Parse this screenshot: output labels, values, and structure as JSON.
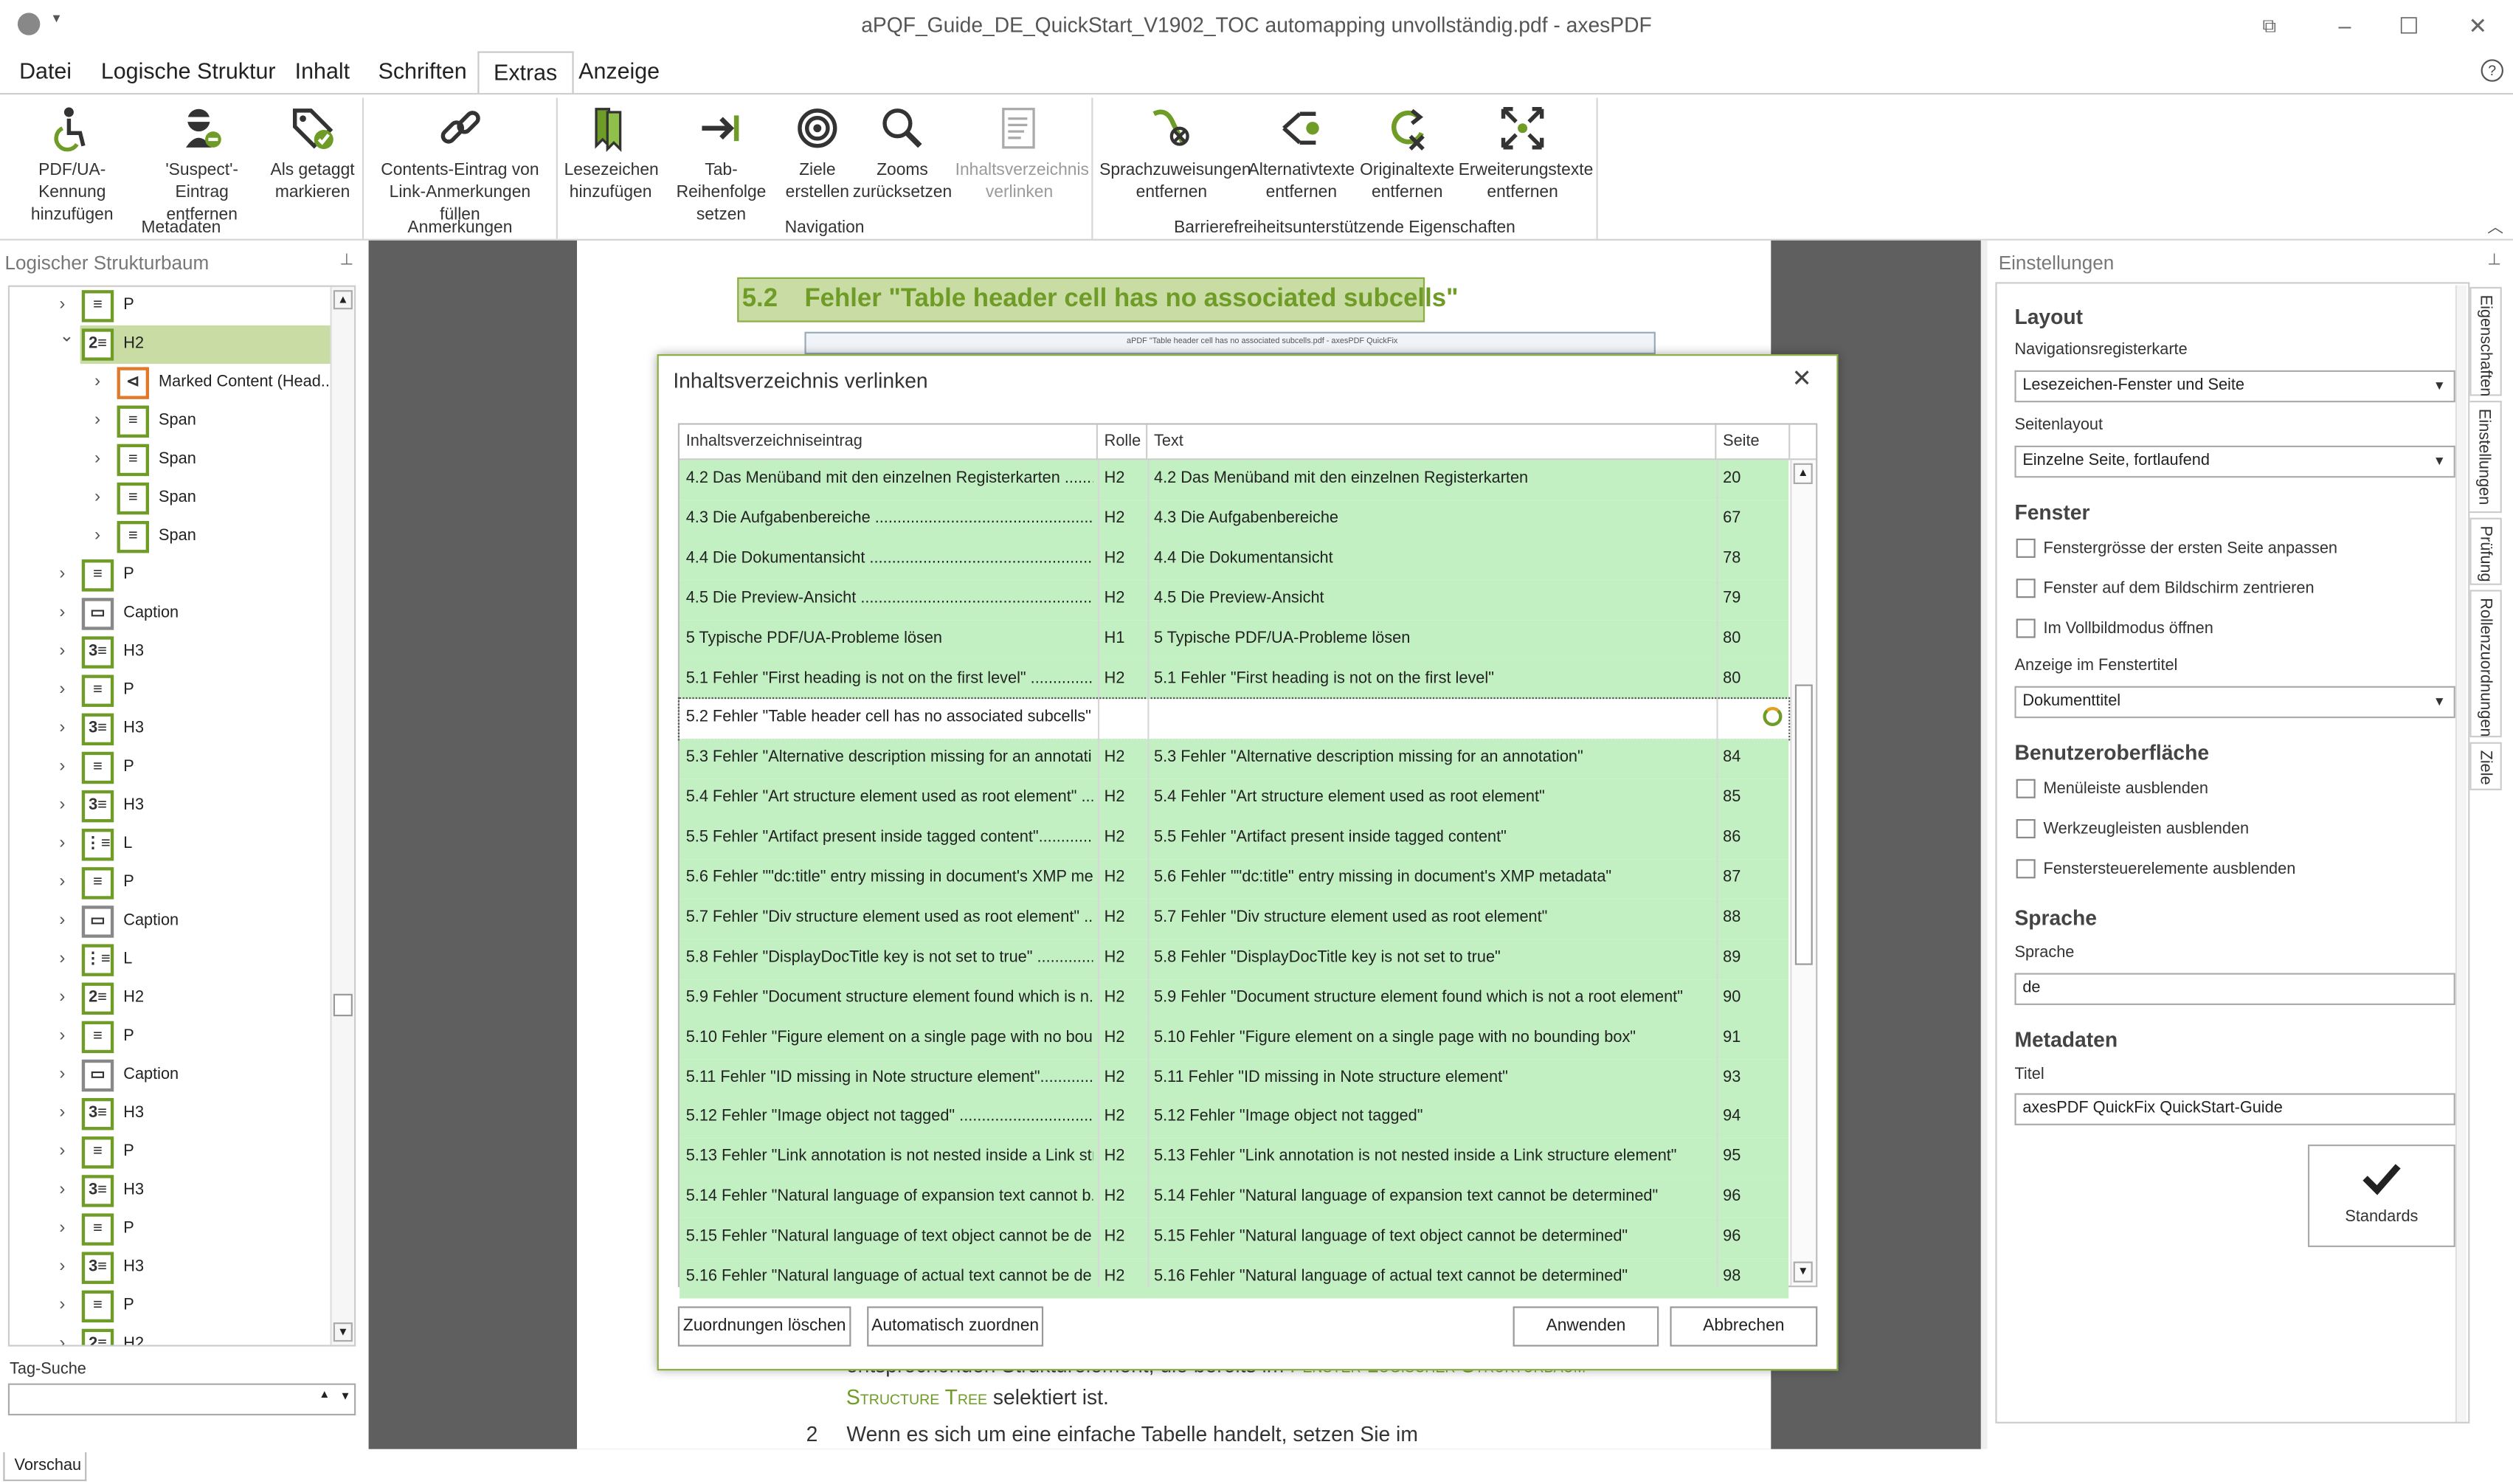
{
  "window": {
    "title": "aPQF_Guide_DE_QuickStart_V1902_TOC automapping unvollständig.pdf - axesPDF"
  },
  "menu": {
    "items": [
      "Datei",
      "Logische Struktur",
      "Inhalt",
      "Schriften",
      "Extras",
      "Anzeige"
    ],
    "active": "Extras"
  },
  "ribbon": {
    "buttons": [
      {
        "l1": "PDF/UA-Kennung",
        "l2": "hinzufügen",
        "icon": "accessibility-icon"
      },
      {
        "l1": "'Suspect'-Eintrag",
        "l2": "entfernen",
        "icon": "suspect-icon"
      },
      {
        "l1": "Als getaggt",
        "l2": "markieren",
        "icon": "tag-check-icon"
      },
      {
        "l1": "Contents-Eintrag von",
        "l2": "Link-Anmerkungen füllen",
        "icon": "link-icon"
      },
      {
        "l1": "Lesezeichen",
        "l2": "hinzufügen",
        "icon": "bookmark-icon"
      },
      {
        "l1": "Tab-Reihenfolge",
        "l2": "setzen",
        "icon": "tab-order-icon"
      },
      {
        "l1": "Ziele",
        "l2": "erstellen",
        "icon": "target-icon"
      },
      {
        "l1": "Zooms",
        "l2": "zurücksetzen",
        "icon": "zoom-icon"
      },
      {
        "l1": "Inhaltsverzeichnis",
        "l2": "verlinken",
        "icon": "toc-icon"
      },
      {
        "l1": "Sprachzuweisungen",
        "l2": "entfernen",
        "icon": "language-remove-icon"
      },
      {
        "l1": "Alternativtexte",
        "l2": "entfernen",
        "icon": "alt-text-remove-icon"
      },
      {
        "l1": "Originaltexte",
        "l2": "entfernen",
        "icon": "original-text-remove-icon"
      },
      {
        "l1": "Erweiterungstexte",
        "l2": "entfernen",
        "icon": "expansion-text-remove-icon"
      }
    ],
    "groups": [
      "Metadaten",
      "Anmerkungen",
      "Navigation",
      "Barrierefreiheitsunterstützende Eigenschaften"
    ]
  },
  "left_panel": {
    "title": "Logischer Strukturbaum",
    "tree": [
      {
        "tag": "P",
        "label": "P",
        "level": 0
      },
      {
        "tag": "H2",
        "label": "H2",
        "level": 0,
        "selected": true,
        "expanded": true
      },
      {
        "tag": "MC",
        "label": "Marked Content (Head...",
        "level": 1
      },
      {
        "tag": "Span",
        "label": "Span",
        "level": 1
      },
      {
        "tag": "Span",
        "label": "Span",
        "level": 1
      },
      {
        "tag": "Span",
        "label": "Span",
        "level": 1
      },
      {
        "tag": "Span",
        "label": "Span",
        "level": 1
      },
      {
        "tag": "P",
        "label": "P",
        "level": 0
      },
      {
        "tag": "Caption",
        "label": "Caption",
        "level": 0
      },
      {
        "tag": "H3",
        "label": "H3",
        "level": 0
      },
      {
        "tag": "P",
        "label": "P",
        "level": 0
      },
      {
        "tag": "H3",
        "label": "H3",
        "level": 0
      },
      {
        "tag": "P",
        "label": "P",
        "level": 0
      },
      {
        "tag": "H3",
        "label": "H3",
        "level": 0
      },
      {
        "tag": "L",
        "label": "L",
        "level": 0
      },
      {
        "tag": "P",
        "label": "P",
        "level": 0
      },
      {
        "tag": "Caption",
        "label": "Caption",
        "level": 0
      },
      {
        "tag": "L",
        "label": "L",
        "level": 0
      },
      {
        "tag": "H2",
        "label": "H2",
        "level": 0
      },
      {
        "tag": "P",
        "label": "P",
        "level": 0
      },
      {
        "tag": "Caption",
        "label": "Caption",
        "level": 0
      },
      {
        "tag": "H3",
        "label": "H3",
        "level": 0
      },
      {
        "tag": "P",
        "label": "P",
        "level": 0
      },
      {
        "tag": "H3",
        "label": "H3",
        "level": 0
      },
      {
        "tag": "P",
        "label": "P",
        "level": 0
      },
      {
        "tag": "H3",
        "label": "H3",
        "level": 0
      },
      {
        "tag": "P",
        "label": "P",
        "level": 0
      },
      {
        "tag": "H2",
        "label": "H2",
        "level": 0
      }
    ],
    "tag_search_label": "Tag-Suche",
    "bottom_tab": "Vorschau"
  },
  "document": {
    "heading_num": "5.2",
    "heading_text": "Fehler \"Table header cell has no associated subcells\"",
    "thumb_title": "aPDF \"Table header cell has no associated subcells.pdf - axesPDF QuickFix",
    "line1": "entsprechenden Strukturelement, die bereits im ",
    "line1_link": "Fenster Logischer Strukturbaum",
    "line2_sc": "Structure Tree",
    "line2_rest": " selektiert ist.",
    "line3": "Wenn es sich um eine einfache Tabelle handelt, setzen Sie im",
    "line3_num": "2"
  },
  "dialog": {
    "title": "Inhaltsverzeichnis verlinken",
    "columns": [
      "Inhaltsverzeichniseintrag",
      "Rolle",
      "Text",
      "Seite"
    ],
    "rows": [
      {
        "entry": "4.2 Das Menüband mit den einzelnen Registerkarten ..........",
        "role": "H2",
        "text": "4.2 Das Menüband mit den einzelnen Registerkarten",
        "page": "20"
      },
      {
        "entry": "4.3 Die Aufgabenbereiche ..........................................................",
        "role": "H2",
        "text": "4.3 Die Aufgabenbereiche",
        "page": "67"
      },
      {
        "entry": "4.4 Die Dokumentansicht ...........................................................",
        "role": "H2",
        "text": "4.4 Die Dokumentansicht",
        "page": "78"
      },
      {
        "entry": "4.5 Die Preview-Ansicht ............................................................",
        "role": "H2",
        "text": "4.5 Die Preview-Ansicht",
        "page": "79"
      },
      {
        "entry": "5 Typische PDF/UA-Probleme lösen",
        "role": "H1",
        "text": "5 Typische PDF/UA-Probleme lösen",
        "page": "80"
      },
      {
        "entry": "5.1 Fehler \"First heading is not on the first level\" ...................",
        "role": "H2",
        "text": "5.1 Fehler \"First heading is not on the first level\"",
        "page": "80"
      },
      {
        "entry": "5.2 Fehler \"Table header cell has no associated subcells\" .......",
        "role": "",
        "text": "",
        "page": "",
        "selected": true
      },
      {
        "entry": "5.3 Fehler \"Alternative description missing for an annotati...",
        "role": "H2",
        "text": "5.3 Fehler \"Alternative description missing for an annotation\"",
        "page": "84"
      },
      {
        "entry": "5.4 Fehler \"Art structure element used as root element\" ........",
        "role": "H2",
        "text": "5.4 Fehler \"Art structure element used as root element\"",
        "page": "85"
      },
      {
        "entry": "5.5 Fehler \"Artifact present inside tagged content\"...................",
        "role": "H2",
        "text": "5.5 Fehler \"Artifact present inside tagged content\"",
        "page": "86"
      },
      {
        "entry": "5.6 Fehler \"\"dc:title\" entry missing in document's XMP me...",
        "role": "H2",
        "text": "5.6 Fehler \"\"dc:title\" entry missing in document's XMP metadata\"",
        "page": "87"
      },
      {
        "entry": "5.7 Fehler \"Div structure element used as root element\" .......",
        "role": "H2",
        "text": "5.7 Fehler \"Div structure element used as root element\"",
        "page": "88"
      },
      {
        "entry": "5.8 Fehler \"DisplayDocTitle key is not set to true\" ...................",
        "role": "H2",
        "text": "5.8 Fehler \"DisplayDocTitle key is not set to true\"",
        "page": "89"
      },
      {
        "entry": "5.9 Fehler \"Document structure element found which is n...",
        "role": "H2",
        "text": "5.9 Fehler \"Document structure element found which is not a root element\"",
        "page": "90"
      },
      {
        "entry": "5.10 Fehler \"Figure element on a single page with no bou...",
        "role": "H2",
        "text": "5.10 Fehler \"Figure element on a single page with no bounding box\"",
        "page": "91"
      },
      {
        "entry": "5.11 Fehler \"ID missing in Note structure element\"....................",
        "role": "H2",
        "text": "5.11 Fehler \"ID missing in Note structure element\"",
        "page": "93"
      },
      {
        "entry": "5.12 Fehler \"Image object not tagged\" ......................................",
        "role": "H2",
        "text": "5.12  Fehler \"Image object not tagged\"",
        "page": "94"
      },
      {
        "entry": "5.13 Fehler \"Link annotation is not nested inside a Link str...",
        "role": "H2",
        "text": "5.13 Fehler \"Link annotation is not nested inside a Link structure element\"",
        "page": "95"
      },
      {
        "entry": "5.14 Fehler \"Natural language of expansion text cannot b...",
        "role": "H2",
        "text": "5.14 Fehler \"Natural language of expansion text cannot be determined\"",
        "page": "96"
      },
      {
        "entry": "5.15 Fehler \"Natural language of text object cannot be de...",
        "role": "H2",
        "text": "5.15 Fehler \"Natural language of text object cannot be determined\"",
        "page": "96"
      },
      {
        "entry": "5.16 Fehler \"Natural language of actual text cannot be de...",
        "role": "H2",
        "text": "5.16 Fehler \"Natural language of actual text cannot be determined\"",
        "page": "98"
      }
    ],
    "btn_clear": "Zuordnungen löschen",
    "btn_auto": "Automatisch zuordnen",
    "btn_apply": "Anwenden",
    "btn_cancel": "Abbrechen"
  },
  "right_panel": {
    "title": "Einstellungen",
    "layout_heading": "Layout",
    "nav_tab_label": "Navigationsregisterkarte",
    "nav_tab_value": "Lesezeichen-Fenster und Seite",
    "page_layout_label": "Seitenlayout",
    "page_layout_value": "Einzelne Seite, fortlaufend",
    "window_heading": "Fenster",
    "window_checks": [
      "Fenstergrösse der ersten Seite anpassen",
      "Fenster auf dem Bildschirm zentrieren",
      "Im Vollbildmodus öffnen"
    ],
    "title_display_label": "Anzeige im Fenstertitel",
    "title_display_value": "Dokumenttitel",
    "ui_heading": "Benutzeroberfläche",
    "ui_checks": [
      "Menüleiste ausblenden",
      "Werkzeugleisten ausblenden",
      "Fenstersteuerelemente ausblenden"
    ],
    "language_heading": "Sprache",
    "language_label": "Sprache",
    "language_value": "de",
    "metadata_heading": "Metadaten",
    "title_label": "Titel",
    "title_value": "axesPDF QuickFix QuickStart-Guide",
    "standards_button": "Standards",
    "side_tabs": [
      "Eigenschaften",
      "Einstellungen",
      "Prüfung",
      "Rollenzuordnungen",
      "Ziele"
    ]
  },
  "colors": {
    "accent_green": "#6f9c27",
    "row_green": "#c3f0c3",
    "tree_selected": "#c8dca4"
  }
}
